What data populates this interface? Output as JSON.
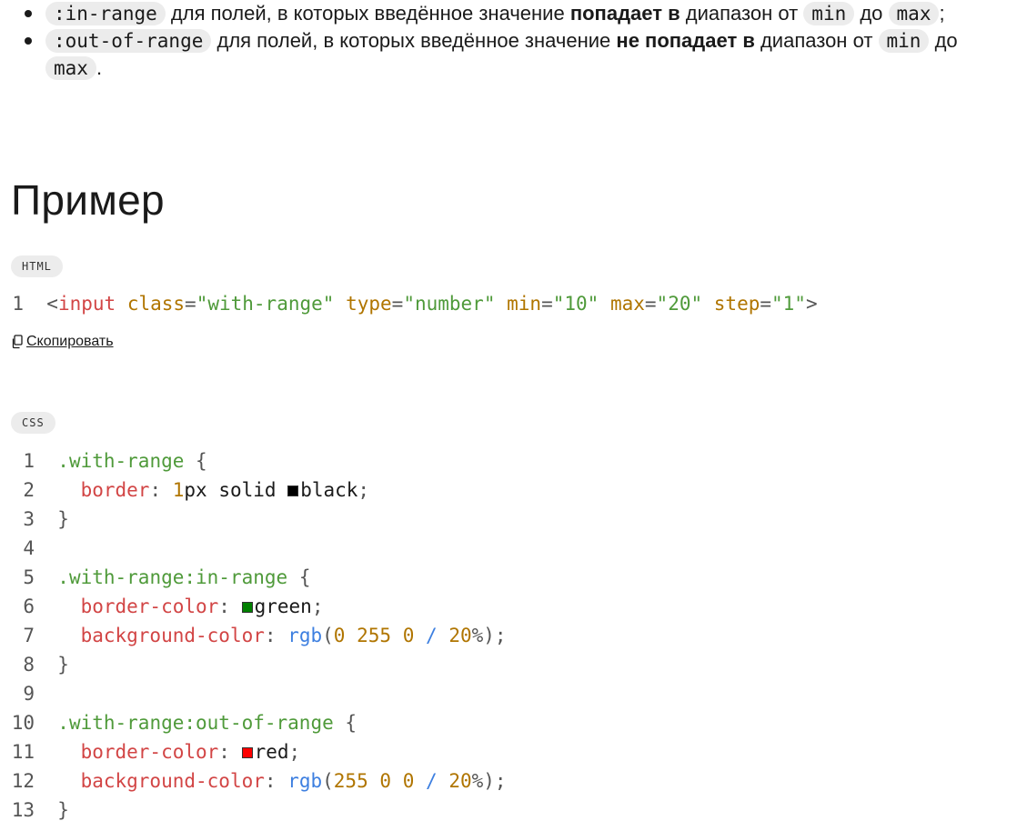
{
  "bullets": [
    {
      "code": ":in-range",
      "text1": " для полей, в которых введённое значение ",
      "bold": "попадает в",
      "text2": " диапазон от ",
      "code_min": "min",
      "text3": " до ",
      "code_max": "max",
      "end": ";"
    },
    {
      "code": ":out-of-range",
      "text1": " для полей, в которых введённое значение ",
      "bold": "не попадает в",
      "text2": " диапазон от ",
      "code_min": "min",
      "text3": " до ",
      "code_max": "max",
      "end": "."
    }
  ],
  "heading": "Пример",
  "html_block": {
    "lang": "HTML",
    "line_no": "1",
    "tag_open": "<",
    "tag": "input",
    "attr1": "class",
    "val1": "\"with-range\"",
    "attr2": "type",
    "val2": "\"number\"",
    "attr3": "min",
    "val3": "\"10\"",
    "attr4": "max",
    "val4": "\"20\"",
    "attr5": "step",
    "val5": "\"1\"",
    "eq": "=",
    "tag_close": ">"
  },
  "copy_label": "Скопировать",
  "css_block": {
    "lang": "CSS",
    "line_numbers": [
      "1",
      "2",
      "3",
      "4",
      "5",
      "6",
      "7",
      "8",
      "9",
      "10",
      "11",
      "12",
      "13"
    ],
    "sel1": ".with-range",
    "sel2": ".with-range:in-range",
    "sel3": ".with-range:out-of-range",
    "brace_open": "{",
    "brace_close": "}",
    "prop_border": "border",
    "prop_border_color": "border-color",
    "prop_bg": "background-color",
    "colon": ":",
    "semi": ";",
    "num_1": "1",
    "unit_px": "px solid ",
    "color_black": "black",
    "color_green": "green",
    "color_red": "red",
    "fn_rgb": "rgb",
    "paren_open": "(",
    "paren_close": ")",
    "green_r": "0",
    "green_g": "255",
    "green_b": "0",
    "red_r": "255",
    "red_g": "0",
    "red_b": "0",
    "slash": "/",
    "alpha": "20",
    "percent": "%"
  },
  "swatch_colors": {
    "black": "#000000",
    "green": "#008000",
    "red": "#ff0000"
  }
}
